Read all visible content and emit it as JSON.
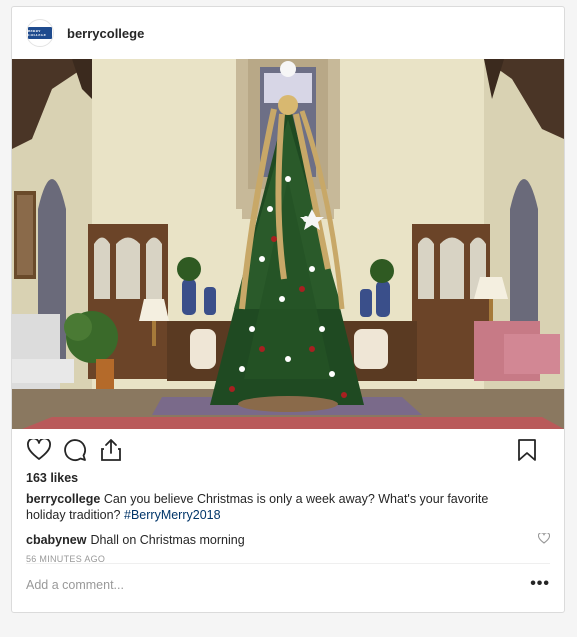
{
  "post": {
    "username": "berrycollege",
    "avatar_text": "BERRY COLLEGE",
    "likes": "163 likes",
    "caption_user": "berrycollege",
    "caption_text": "Can you believe Christmas is only a week away? What's your favorite holiday tradition?",
    "caption_hashtag": "#BerryMerry2018",
    "comment_user": "cbabynew",
    "comment_text": "Dhall on Christmas morning",
    "timestamp": "56 MINUTES AGO",
    "add_comment_placeholder": "Add a comment...",
    "more_label": "•••"
  },
  "icons": {
    "like": "heart-icon",
    "comment": "comment-icon",
    "share": "share-icon",
    "save": "bookmark-icon",
    "comment_like": "heart-icon",
    "options": "more-options-icon"
  },
  "colors": {
    "background": "#f5f5f5",
    "card_border": "#dbdbdb",
    "text": "#262626",
    "muted": "#999999",
    "hashtag": "#003569"
  }
}
